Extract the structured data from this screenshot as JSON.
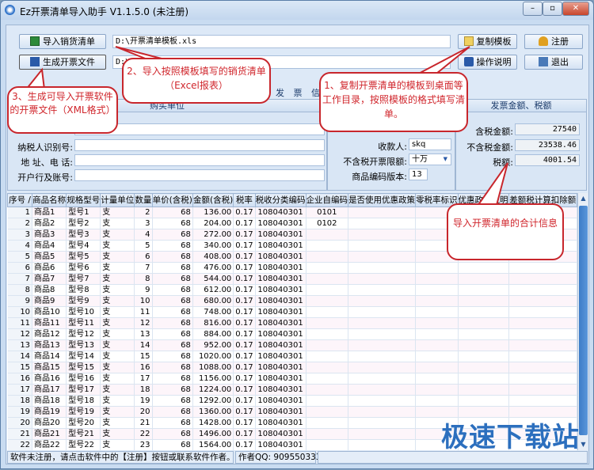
{
  "window": {
    "title": "Ez开票清单导入助手 V1.1.5.0 (未注册)",
    "minimize": "–",
    "maximize": "▫",
    "close": "✕"
  },
  "toolbar": {
    "import_label": "导入销货清单",
    "import_path": "D:\\开票清单模板.xls",
    "generate_label": "生成开票文件",
    "generate_path": "D:\\",
    "copy_template_label": "复制模板",
    "instructions_label": "操作说明",
    "register_label": "注册",
    "exit_label": "退出"
  },
  "invoice_tab": "发 票 信 息",
  "buyer": {
    "header": "购买单位",
    "tax_id_label": "纳税人识别号:",
    "address_label": "地 址、电 话:",
    "bank_label": "开户行及账号:",
    "name_value": "",
    "tax_id_value": "",
    "address_value": "",
    "bank_value": ""
  },
  "issuer": {
    "payee_label": "收款人:",
    "payee_value": "skq",
    "limit_label": "不含税开票限额:",
    "limit_value": "十万",
    "code_version_label": "商品编码版本:",
    "code_version_value": "13"
  },
  "totals": {
    "header": "发票金额、税额",
    "incl_label": "含税金额:",
    "incl_value": "27540",
    "excl_label": "不含税金额:",
    "excl_value": "23538.46",
    "tax_label": "税额:",
    "tax_value": "4001.54"
  },
  "grid": {
    "columns": [
      "序号 /",
      "商品名称",
      "规格型号",
      "计量单位",
      "数量",
      "单价(含税)",
      "金额(含税)",
      "税率",
      "税收分类编码",
      "企业自编码",
      "是否使用优惠政策",
      "零税率标识",
      "优惠政策说明",
      "差额税计算扣除额"
    ],
    "rows": [
      [
        "1",
        "商品1",
        "型号1",
        "支",
        "2",
        "68",
        "136.00",
        "0.17",
        "108040301",
        "0101"
      ],
      [
        "2",
        "商品2",
        "型号2",
        "支",
        "3",
        "68",
        "204.00",
        "0.17",
        "108040301",
        "0102"
      ],
      [
        "3",
        "商品3",
        "型号3",
        "支",
        "4",
        "68",
        "272.00",
        "0.17",
        "108040301",
        ""
      ],
      [
        "4",
        "商品4",
        "型号4",
        "支",
        "5",
        "68",
        "340.00",
        "0.17",
        "108040301",
        ""
      ],
      [
        "5",
        "商品5",
        "型号5",
        "支",
        "6",
        "68",
        "408.00",
        "0.17",
        "108040301",
        ""
      ],
      [
        "6",
        "商品6",
        "型号6",
        "支",
        "7",
        "68",
        "476.00",
        "0.17",
        "108040301",
        ""
      ],
      [
        "7",
        "商品7",
        "型号7",
        "支",
        "8",
        "68",
        "544.00",
        "0.17",
        "108040301",
        ""
      ],
      [
        "8",
        "商品8",
        "型号8",
        "支",
        "9",
        "68",
        "612.00",
        "0.17",
        "108040301",
        ""
      ],
      [
        "9",
        "商品9",
        "型号9",
        "支",
        "10",
        "68",
        "680.00",
        "0.17",
        "108040301",
        ""
      ],
      [
        "10",
        "商品10",
        "型号10",
        "支",
        "11",
        "68",
        "748.00",
        "0.17",
        "108040301",
        ""
      ],
      [
        "11",
        "商品11",
        "型号11",
        "支",
        "12",
        "68",
        "816.00",
        "0.17",
        "108040301",
        ""
      ],
      [
        "12",
        "商品12",
        "型号12",
        "支",
        "13",
        "68",
        "884.00",
        "0.17",
        "108040301",
        ""
      ],
      [
        "13",
        "商品13",
        "型号13",
        "支",
        "14",
        "68",
        "952.00",
        "0.17",
        "108040301",
        ""
      ],
      [
        "14",
        "商品14",
        "型号14",
        "支",
        "15",
        "68",
        "1020.00",
        "0.17",
        "108040301",
        ""
      ],
      [
        "15",
        "商品15",
        "型号15",
        "支",
        "16",
        "68",
        "1088.00",
        "0.17",
        "108040301",
        ""
      ],
      [
        "16",
        "商品16",
        "型号16",
        "支",
        "17",
        "68",
        "1156.00",
        "0.17",
        "108040301",
        ""
      ],
      [
        "17",
        "商品17",
        "型号17",
        "支",
        "18",
        "68",
        "1224.00",
        "0.17",
        "108040301",
        ""
      ],
      [
        "18",
        "商品18",
        "型号18",
        "支",
        "19",
        "68",
        "1292.00",
        "0.17",
        "108040301",
        ""
      ],
      [
        "19",
        "商品19",
        "型号19",
        "支",
        "20",
        "68",
        "1360.00",
        "0.17",
        "108040301",
        ""
      ],
      [
        "20",
        "商品20",
        "型号20",
        "支",
        "21",
        "68",
        "1428.00",
        "0.17",
        "108040301",
        ""
      ],
      [
        "21",
        "商品21",
        "型号21",
        "支",
        "22",
        "68",
        "1496.00",
        "0.17",
        "108040301",
        ""
      ],
      [
        "22",
        "商品22",
        "型号22",
        "支",
        "23",
        "68",
        "1564.00",
        "0.17",
        "108040301",
        ""
      ],
      [
        "23",
        "商品23",
        "型号23",
        "支",
        "24",
        "68",
        "1632.00",
        "0.17",
        "108040301",
        ""
      ]
    ]
  },
  "status": {
    "message": "软件未注册，请点击软件中的【注册】按钮或联系软件作者。",
    "author_qq": "作者QQ: 909550333"
  },
  "callouts": {
    "c1": "1、复制开票清单的模板到桌面等工作目录，按照模板的格式填写清单。",
    "c2": "2、导入按照模板填写的销货清单（Excel报表）",
    "c3": "3、生成可导入开票软件的开票文件（XML格式）",
    "c4": "导入开票清单的合计信息"
  },
  "watermark": "极速下载站",
  "colors": {
    "callout_border": "#c8262c",
    "accent": "#2c6fbe"
  }
}
